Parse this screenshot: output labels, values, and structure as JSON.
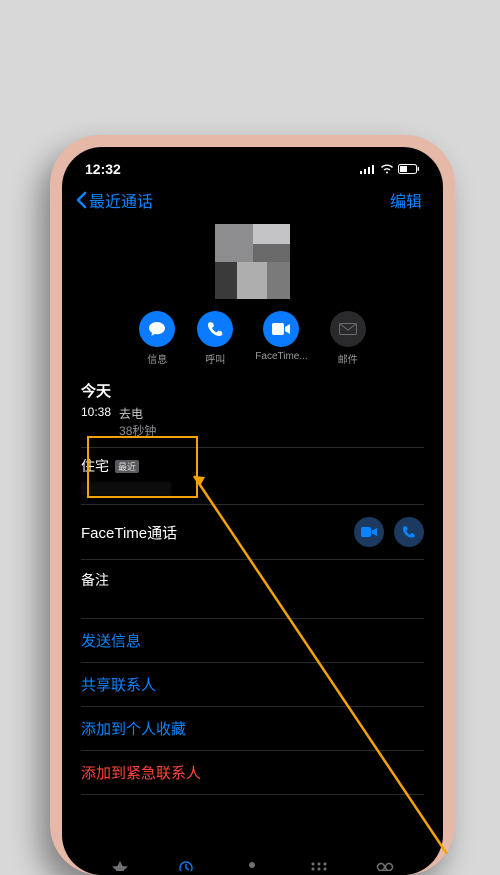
{
  "status": {
    "time": "12:32"
  },
  "nav": {
    "back_label": "最近通话",
    "edit_label": "编辑"
  },
  "actions": {
    "message": "信息",
    "call": "呼叫",
    "facetime": "FaceTime...",
    "mail": "邮件"
  },
  "calllog": {
    "day": "今天",
    "time": "10:38",
    "direction": "去电",
    "duration": "38秒钟"
  },
  "home": {
    "label": "住宅",
    "tag": "最近"
  },
  "facetime_row": "FaceTime通话",
  "notes_label": "备注",
  "links": {
    "send_message": "发送信息",
    "share_contact": "共享联系人",
    "add_favorite": "添加到个人收藏",
    "add_emergency": "添加到紧急联系人"
  }
}
